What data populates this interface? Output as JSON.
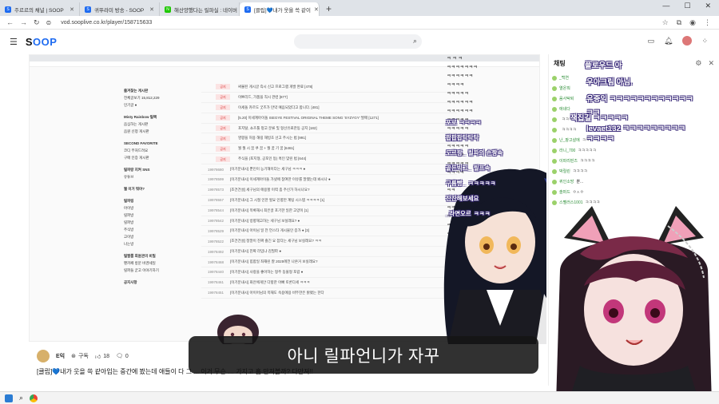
{
  "browser": {
    "tabs": [
      {
        "label": "주르르의 채널 | SOOP",
        "color": "#1e6bf1"
      },
      {
        "label": "귀뚜라미 방송 - SOOP",
        "color": "#1e6bf1"
      },
      {
        "label": "해산양했다는 릴파실 : 네이버",
        "color": "#1ec800"
      },
      {
        "label": "[클립]💙내가 웃을 쓱 같이",
        "color": "#1e6bf1"
      }
    ],
    "url": "vod.sooplive.co.kr/player/158715633"
  },
  "header": {
    "logo_main": "S",
    "logo_accent": "OOP",
    "login_label": "개인화"
  },
  "subtitle": "아니 릴파언니가 자꾸",
  "channel": {
    "name": "E익",
    "subscribe_label": "구독",
    "like_count": "18",
    "comment_count": "0"
  },
  "video_title": "[클립]💙내가 웃을 쓱 같아입는 중간에 봤는데 애들이 다 그 ... 이거 무슨 … 가지고 흠 만져볼까? 다만져!!",
  "inner_cafe": {
    "side_items": [
      "즐겨찾는 게시판",
      "전체글보기 15,812,229",
      "인기글 ●",
      "Misty Rainbow 릴팩",
      "음심하는 게시판",
      "음원 신청 게시판",
      "SECOND FAVORITE",
      "코디 부처드려요",
      "구매 인증 게시판",
      "릴파랑 지켜 SNS",
      "유튜브",
      "뭘 이거 뭐야?",
      "릴파링",
      "아이방",
      "릴파방",
      "릴파방",
      "주식방",
      "고이방",
      "나는방",
      "릴팔룸 회원관의 비밀",
      "팬카페 방문 바겐세일",
      "릴파들 굳고 이야기하기",
      "공지사항"
    ],
    "rows": [
      {
        "badge": "공지",
        "num": "",
        "title": "싸불된 게시글 즉시 신고 프로그램 개발 완료 [478]"
      },
      {
        "badge": "공지",
        "num": "",
        "title": "이쁘리드, 가품을 직시 관련 [877]"
      },
      {
        "badge": "공지",
        "num": "",
        "title": "이세돌 카르도 굿즈가 만약 예음되었다고 합니다. [481]"
      },
      {
        "badge": "공지",
        "num": "",
        "title": "[5.20] 이세계아이돌 ISEGYE FESTIVAL ORIGINAL THEME SONG 'SYZYGY' 발매 [1271]"
      },
      {
        "badge": "공지",
        "num": "",
        "title": "포지탈, 쇼츠툴 펑고 분류 및 형선유료한동 공지 [182]"
      },
      {
        "badge": "공지",
        "num": "",
        "title": "영향을 허용 해링 해빙초 선고 주시는 법 [991]"
      },
      {
        "badge": "공지",
        "num": "",
        "title": "뭘 뭘 시 꿈 쿠 꿈 + 뭘 꿈 기 꿈 [6461]"
      },
      {
        "badge": "공지",
        "num": "",
        "title": "주식을 (포지형, 공포인 등) 혹인 맞린 법 [644]"
      },
      {
        "badge": "",
        "num": "19978680",
        "title": "[이기분내시] 뿐인이 능기해이다는 세구님 ㅋㅋㅋ ●"
      },
      {
        "badge": "",
        "num": "19978599",
        "title": "[이기분내시] 이세계아이돌 가넷에 참여한 이유를 말했는데 봐시나 ●"
      },
      {
        "badge": "",
        "num": "19978573",
        "title": "[조건건설] 세구님의 애용할 이력 좀 주신가 하시나요?"
      },
      {
        "badge": "",
        "num": "19978557",
        "title": "[이기분내시] 그 시절 인한 헐요 인향만 계팅 시스템 ㅋㅋㅋㅋ [1]"
      },
      {
        "badge": "",
        "num": "19978544",
        "title": "[이기분내시] 목록해시 최은골 포기한 일한 고양이 [1]"
      },
      {
        "badge": "",
        "num": "19978542",
        "title": "[이기분내시] 방향해고하는 세구님 보실래요? ●"
      },
      {
        "badge": "",
        "num": "19978529",
        "title": "[이기분내시] 아이님 일 전 언스타 게시물인 증가 ● [3]"
      },
      {
        "badge": "",
        "num": "19978522",
        "title": "[조건건설] 정말이 진짜 즐긴 요 잡다는 세구님 보실래요? ㅋㅋ"
      },
      {
        "badge": "",
        "num": "19978492",
        "title": "[이기분내시] 진짜 라임냐 김필파 ●"
      },
      {
        "badge": "",
        "num": "19978468",
        "title": "[이기분내시] 힙합일 좌재린 잘 2025에전 나온거 보실래요?"
      },
      {
        "badge": "",
        "num": "19978440",
        "title": "[이기분내시] 사랑을 좋아하는 형주 동물형 포랍 ●"
      },
      {
        "badge": "",
        "num": "19978461",
        "title": "[이기분내시] 화안에게안 다항한 아빠 토론다세 ㅋㅋㅋ"
      },
      {
        "badge": "",
        "num": "19978451",
        "title": "[이기분내시] 아이어님의 목재도 속용에용 비뚜한은 밝혔는 한다"
      }
    ],
    "overlay_chat": [
      "ㅋ ㅋ ㅋ",
      "ㅋㅋㅋㅋㅋㅋㅋ",
      "ㅋㅋㅋㅋㅋㅋ",
      "ㅋㅋㅋㅋ",
      "ㅋㅋㅋㅋㅋ",
      "ㅋㅋㅋㅋㅋㅋ",
      "ㅋㅋㅋㅋㅋㅋ",
      "ㅋㅋㅋㅋㅋ",
      "ㅋㅋㅋㅋㅋ",
      "ㅋㅋㅋㅋㅋ",
      "ㅋㅋㅋㅋㅋ",
      "ㅋㅋㅋㅋ",
      "ㅋㅋㅋㅋㅋ",
      "ㅋㅋㅋㅋ",
      "ㅋㅋㅋ",
      "ㅋㅋ",
      "ㅋㅋㅋㅋ",
      "ㅋㅋ",
      "ㅋㅋㅋㅋㅋㅋ",
      "ㅋㅋㅋㅋㅋ",
      "ㅋ ㅋㅋ"
    ],
    "video_overlay_msgs": [
      {
        "name": "포로",
        "text": "ㅋㅋㅋㅋ"
      },
      {
        "name": "",
        "text": "팝팝팝탁탁탁"
      },
      {
        "name": "도르팡_",
        "text": "릴파의 손짱속"
      },
      {
        "name": "골든빅그_",
        "text": "릴프속"
      },
      {
        "name": "구름빵_",
        "text": "ㅋㅋㅋㅋㅋ"
      },
      {
        "name": "",
        "text": "잔잔해보세요"
      },
      {
        "name": "_라면오르",
        "text": "ㅋㅋㅋ"
      }
    ]
  },
  "chat": {
    "title": "채팅",
    "messages": [
      {
        "name": "_백연",
        "text": ""
      },
      {
        "name": "열온뭐",
        "text": ""
      },
      {
        "name": "음사탁퇴",
        "text": ""
      },
      {
        "name": "애네다",
        "text": ""
      },
      {
        "name": "",
        "text": "ㅋㅋㅋㅋㅋ"
      },
      {
        "name": "",
        "text": "ㅋㅋㅋㅋ"
      },
      {
        "name": "난_팡고살에",
        "text": "ㅋㅋㅋㅋㅋㅋ"
      },
      {
        "name": "라니_700",
        "text": "ㅋㅋㅋㅋㅋ"
      },
      {
        "name": "이파리핀즈",
        "text": "ㅋㅋㅋㅋ"
      },
      {
        "name": "박릴린",
        "text": "ㅋㅋㅋㅋ"
      },
      {
        "name": "퀴인소망",
        "text": "뿐..."
      },
      {
        "name": "솔퍼드",
        "text": "ㅇㅅㅇ"
      },
      {
        "name": "스펠러스1001",
        "text": "ㅋㅋㅋㅋ"
      }
    ],
    "overlay": [
      {
        "text": "플로우드 아",
        "tag": ""
      },
      {
        "text": "우아크림 아님.",
        "tag": ""
      },
      {
        "text": "유중익 ㅋㅋㅋㅋㅋㅋㅋㅋㅋㅋㅋㅋ",
        "tag": ""
      },
      {
        "text": "ㅋㅋ",
        "tag": ""
      },
      {
        "text": "잭집길 ㅋㅋㅋㅋㅋ",
        "tag": ""
      },
      {
        "text": "levaet132 ㅋㅋㅋㅋㅋㅋㅋㅋㅋ",
        "tag": ""
      },
      {
        "text": "ㅋㅋㅋㅋ",
        "tag": ""
      }
    ]
  },
  "taskbar": {
    "icons": [
      "windows-icon",
      "search-icon",
      "chrome-icon"
    ]
  }
}
